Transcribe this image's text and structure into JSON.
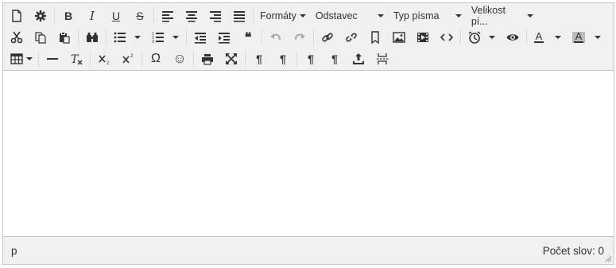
{
  "toolbar": {
    "formats_label": "Formáty",
    "block_label": "Odstavec",
    "font_family_label": "Typ písma",
    "font_size_label": "Velikost pí...",
    "bold": "B",
    "italic": "I",
    "underline": "U",
    "strike": "S",
    "text_color_letter": "A",
    "bg_color_letter": "A",
    "text_color": "#333333",
    "bg_color": "#bbbbbb",
    "omega": "Ω",
    "smiley": "☺",
    "para1": "¶",
    "para2": "¶",
    "para_ltr": "¶",
    "para_rtl": "¶",
    "quote": "❝"
  },
  "statusbar": {
    "path": "p",
    "word_count": "Počet slov: 0"
  }
}
